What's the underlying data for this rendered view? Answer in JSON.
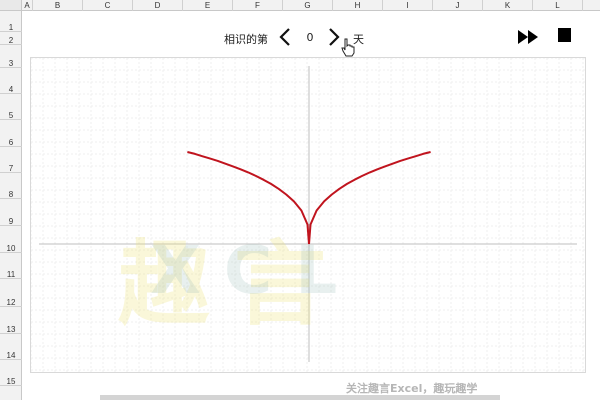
{
  "spreadsheet": {
    "columns": [
      "A",
      "B",
      "C",
      "D",
      "E",
      "F",
      "G",
      "H",
      "I",
      "J",
      "K",
      "L"
    ],
    "rows": [
      "1",
      "2",
      "3",
      "4",
      "5",
      "6",
      "7",
      "8",
      "9",
      "10",
      "11",
      "12",
      "13",
      "14",
      "15"
    ]
  },
  "controls": {
    "prefix": "相识的第",
    "day_value": "0",
    "suffix": "天",
    "prev_icon": "chevron-left-icon",
    "next_icon": "chevron-right-icon",
    "play_icon": "fast-forward-icon",
    "stop_icon": "stop-icon"
  },
  "chart_data": {
    "type": "line",
    "title": "",
    "xlabel": "",
    "ylabel": "",
    "grid": true,
    "axis_color": "#bfbfbf",
    "series": [
      {
        "color": "#c0141e",
        "x": [
          0,
          0.1,
          0.5,
          1.0,
          1.5,
          2.0,
          2.5,
          3.0,
          3.5,
          4.0,
          4.5,
          5.0,
          5.5,
          6.0,
          6.5,
          7.0,
          7.5,
          8.0
        ],
        "y": [
          0,
          1.0,
          1.72,
          2.19,
          2.54,
          2.83,
          3.08,
          3.3,
          3.49,
          3.67,
          3.83,
          3.98,
          4.12,
          4.26,
          4.38,
          4.5,
          4.62,
          4.72
        ]
      },
      {
        "color": "#c0141e",
        "x": [
          0,
          -0.1,
          -0.5,
          -1.0,
          -1.5,
          -2.0,
          -2.5,
          -3.0,
          -3.5,
          -4.0,
          -4.5,
          -5.0,
          -5.5,
          -6.0,
          -6.5,
          -7.0,
          -7.5,
          -8.0
        ],
        "y": [
          0,
          1.0,
          1.72,
          2.19,
          2.54,
          2.83,
          3.08,
          3.3,
          3.49,
          3.67,
          3.83,
          3.98,
          4.12,
          4.26,
          4.38,
          4.5,
          4.62,
          4.72
        ]
      }
    ]
  },
  "watermark": {
    "logo_text": "趣 言",
    "logo_letters": "X C L",
    "caption": "关注趣言Excel，趣玩趣学"
  }
}
